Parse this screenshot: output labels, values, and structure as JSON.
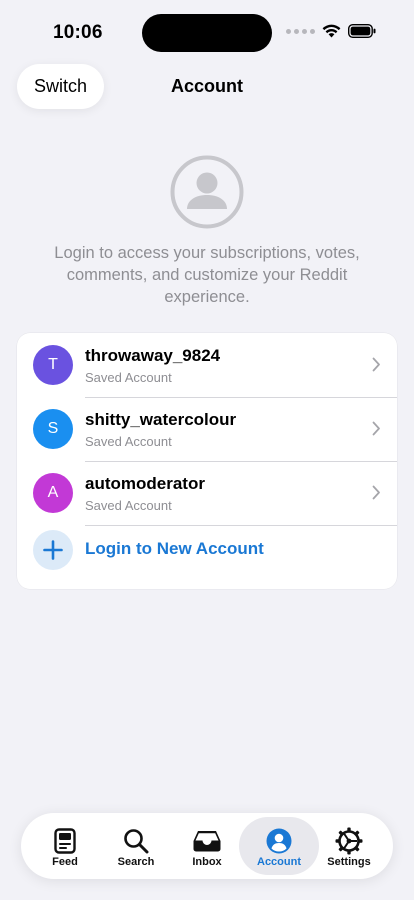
{
  "status_bar": {
    "time": "10:06"
  },
  "nav": {
    "switch_label": "Switch",
    "title": "Account"
  },
  "login_message": "Login to access your subscriptions, votes, comments, and customize your Reddit experience.",
  "accounts": [
    {
      "initial": "T",
      "name": "throwaway_9824",
      "status": "Saved Account",
      "color": "#6a52e0"
    },
    {
      "initial": "S",
      "name": "shitty_watercolour",
      "status": "Saved Account",
      "color": "#1a8ff0"
    },
    {
      "initial": "A",
      "name": "automoderator",
      "status": "Saved Account",
      "color": "#c239d6"
    }
  ],
  "login_new": {
    "label": "Login to New Account",
    "icon": "plus-icon"
  },
  "tabs": [
    {
      "label": "Feed",
      "icon": "feed-icon",
      "active": false
    },
    {
      "label": "Search",
      "icon": "search-icon",
      "active": false
    },
    {
      "label": "Inbox",
      "icon": "inbox-icon",
      "active": false
    },
    {
      "label": "Account",
      "icon": "account-icon",
      "active": true
    },
    {
      "label": "Settings",
      "icon": "settings-gear-icon",
      "active": false
    }
  ],
  "colors": {
    "accent": "#1a78d4",
    "background": "#f2f2f7",
    "secondary_text": "#8e8e93"
  }
}
